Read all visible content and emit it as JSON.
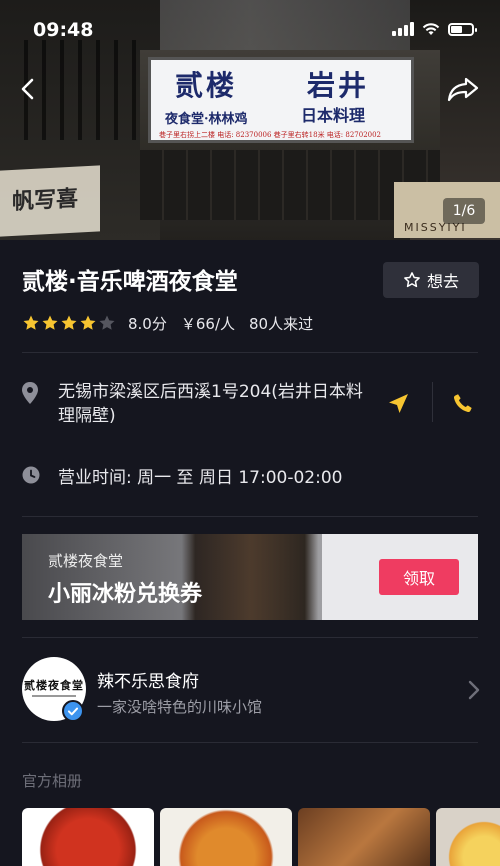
{
  "status_bar": {
    "time": "09:48"
  },
  "hero": {
    "photo_counter": "1/6",
    "sign_main_left": "贰楼",
    "sign_main_right": "岩井",
    "sign_sub_left": "夜食堂·林林鸡",
    "sign_sub_right": "日本料理",
    "sign_fineprint": "巷子里右拐上二楼 电话: 82370006    巷子里右转18米 电话: 82702002",
    "left_sign_text": "帆写喜",
    "right_sign_text": "MISSYIYI"
  },
  "shop": {
    "name": "贰楼·音乐啤酒夜食堂",
    "want_label": "想去",
    "rating": 4,
    "rating_max": 5,
    "score": "8.0分",
    "price": "￥66/人",
    "visitors": "80人来过",
    "star_color": "#f7c531",
    "address": "无锡市梁溪区后西溪1号204(岩井日本料理隔壁)",
    "hours": "营业时间: 周一 至 周日  17:00-02:00"
  },
  "coupon": {
    "subtitle": "贰楼夜食堂",
    "title": "小丽冰粉兑换券",
    "claim_label": "领取",
    "claim_color": "#ef3c61"
  },
  "brand": {
    "avatar_text": "贰楼夜食堂",
    "name": "辣不乐思食府",
    "description": "一家没啥特色的川味小馆"
  },
  "album": {
    "title": "官方相册"
  },
  "colors": {
    "background": "#15161f",
    "accent_yellow": "#f7c531",
    "verified_blue": "#3d94ef"
  }
}
